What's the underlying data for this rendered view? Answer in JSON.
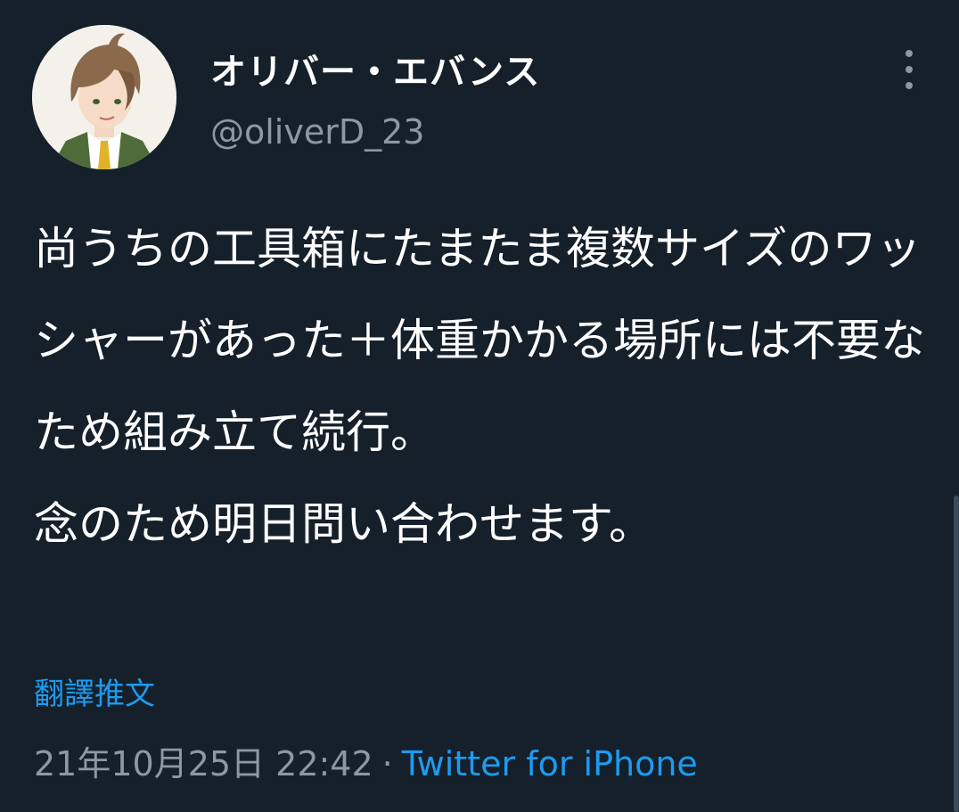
{
  "author": {
    "display_name": "オリバー・エバンス",
    "handle": "@oliverD_23",
    "avatar_icon": "anime-character-avatar"
  },
  "more_icon": "more-vertical-icon",
  "tweet": {
    "text": "尚うちの工具箱にたまたま複数サイズのワッシャーがあった＋体重かかる場所には不要なため組み立て続行。\n念のため明日問い合わせます。",
    "translate_label": "翻譯推文",
    "timestamp": "21年10月25日 22:42",
    "separator": "·",
    "source": "Twitter for iPhone"
  },
  "colors": {
    "background": "#15202b",
    "text_primary": "#ffffff",
    "text_secondary": "#8b98a5",
    "accent": "#1d9bf0"
  }
}
